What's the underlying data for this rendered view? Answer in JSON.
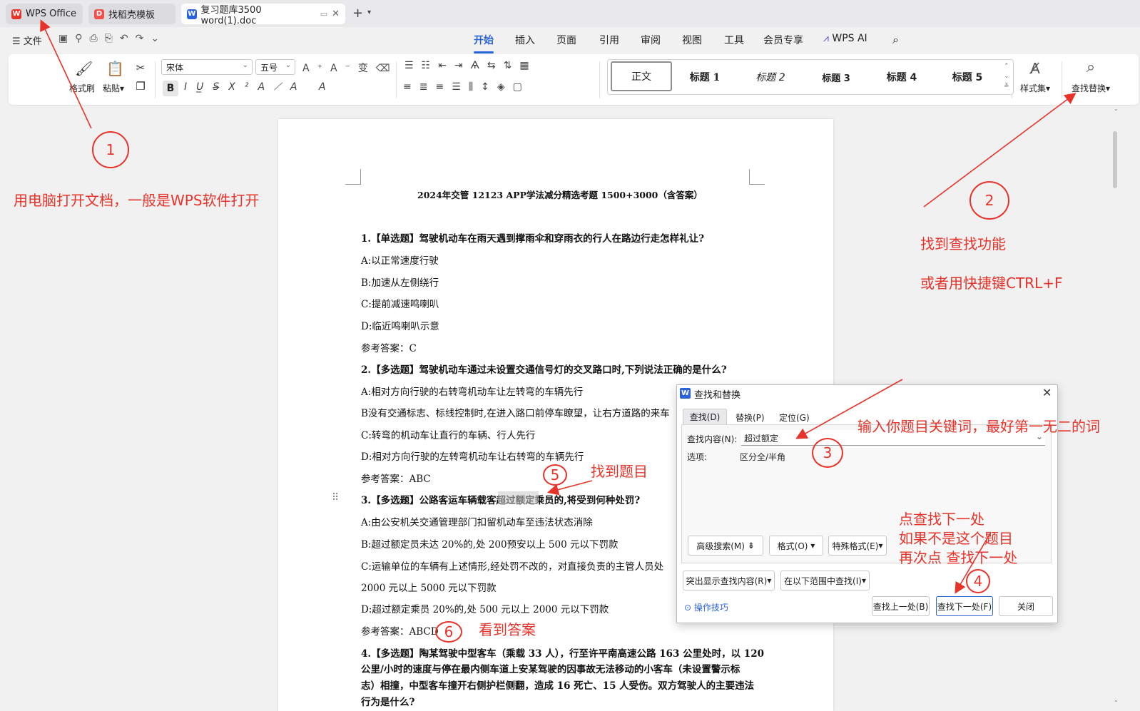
{
  "tabs": [
    {
      "label": "WPS Office",
      "icon": "wps-logo-icon"
    },
    {
      "label": "找稻壳模板",
      "icon": "docer-icon"
    },
    {
      "label": "复习题库3500 word(1).doc",
      "icon": "word-doc-icon"
    }
  ],
  "menu": {
    "file": "文件",
    "items": [
      "开始",
      "插入",
      "页面",
      "引用",
      "审阅",
      "视图",
      "工具",
      "会员专享"
    ],
    "ai": "WPS AI",
    "active": "开始"
  },
  "ribbon": {
    "format_painter": "格式刷",
    "paste": "粘贴",
    "font": "宋体",
    "size": "五号",
    "styles": [
      "正文",
      "标题 1",
      "标题 2",
      "标题 3",
      "标题 4",
      "标题 5"
    ],
    "style_set": "样式集",
    "find_replace": "查找替换"
  },
  "doc": {
    "title": "2024年交管 12123 APP学法减分精选考题 1500+3000（含答案）",
    "lines": [
      {
        "t": "1.【单选题】驾驶机动车在雨天遇到撑雨伞和穿雨衣的行人在路边行走怎样礼让?",
        "b": true
      },
      {
        "t": "A:以正常速度行驶"
      },
      {
        "t": "B:加速从左侧绕行"
      },
      {
        "t": "C:提前减速鸣喇叭"
      },
      {
        "t": "D:临近鸣喇叭示意"
      },
      {
        "t": "参考答案：C"
      },
      {
        "t": "2.【多选题】驾驶机动车通过未设置交通信号灯的交叉路口时,下列说法正确的是什么?",
        "b": true
      },
      {
        "t": "A:相对方向行驶的右转弯机动车让左转弯的车辆先行"
      },
      {
        "t": "B没有交通标志、标线控制时,在进入路口前停车瞭望，让右方道路的来车"
      },
      {
        "t": "C:转弯的机动车让直行的车辆、行人先行"
      },
      {
        "t": "D:相对方向行驶的左转弯机动车让右转弯的车辆先行"
      },
      {
        "t": "参考答案：ABC"
      },
      {
        "t": "3.【多选题】公路客运车辆载客超过额定乘员的,将受到何种处罚?",
        "b": true
      },
      {
        "t": "A:由公安机关交通管理部门扣留机动车至违法状态消除"
      },
      {
        "t": "B:超过额定员未达 20%的,处 200预安以上 500 元以下罚款"
      },
      {
        "t": "C:运输单位的车辆有上述情形,经处罚不改的，对直接负责的主管人员处"
      },
      {
        "t": "2000 元以上 5000 元以下罚款"
      },
      {
        "t": "D:超过额定乘员 20%的,处 500 元以上 2000 元以下罚款"
      },
      {
        "t": "参考答案：ABCD"
      },
      {
        "t": "4.【多选题】陶某驾驶中型客车（乘载 33 人），行至许平南高速公路 163 公里处时，以 120",
        "b": true
      },
      {
        "t": "公里/小时的速度与停在最内侧车道上安某驾驶的因事故无法移动的小客车（未设置警示标",
        "b": true
      },
      {
        "t": "志）相撞，中型客车撞开右侧护栏侧翻，造成 16 死亡、15 人受伤。双方驾驶人的主要违法",
        "b": true
      },
      {
        "t": "行为是什么?",
        "b": true
      }
    ]
  },
  "dialog": {
    "title": "查找和替换",
    "tabs": [
      "查找(D)",
      "替换(P)",
      "定位(G)"
    ],
    "find_label": "查找内容(N):",
    "find_value": "超过额定",
    "options_label": "选项:",
    "options_value": "区分全/半角",
    "advanced": "高级搜索(M)",
    "format": "格式(O)",
    "special": "特殊格式(E)",
    "highlight": "突出显示查找内容(R)",
    "scope": "在以下范围中查找(I)",
    "tips": "操作技巧",
    "prev": "查找上一处(B)",
    "next": "查找下一处(F)",
    "close": "关闭"
  },
  "annotations": {
    "n1": "1",
    "n2": "2",
    "n3": "3",
    "n4": "4",
    "n5": "5",
    "n6": "6",
    "a1": "用电脑打开文档，一般是WPS软件打开",
    "a2a": "找到查找功能",
    "a2b": "或者用快捷键CTRL+F",
    "a3": "输入你题目关键词，最好第一无二的词",
    "a4a": "点查找下一处",
    "a4b": "如果不是这个题目",
    "a4c": "再次点 查找下一处",
    "a5": "找到题目",
    "a6": "看到答案"
  },
  "colors": {
    "annotation": "#e8332a",
    "accent": "#2a62d9"
  }
}
